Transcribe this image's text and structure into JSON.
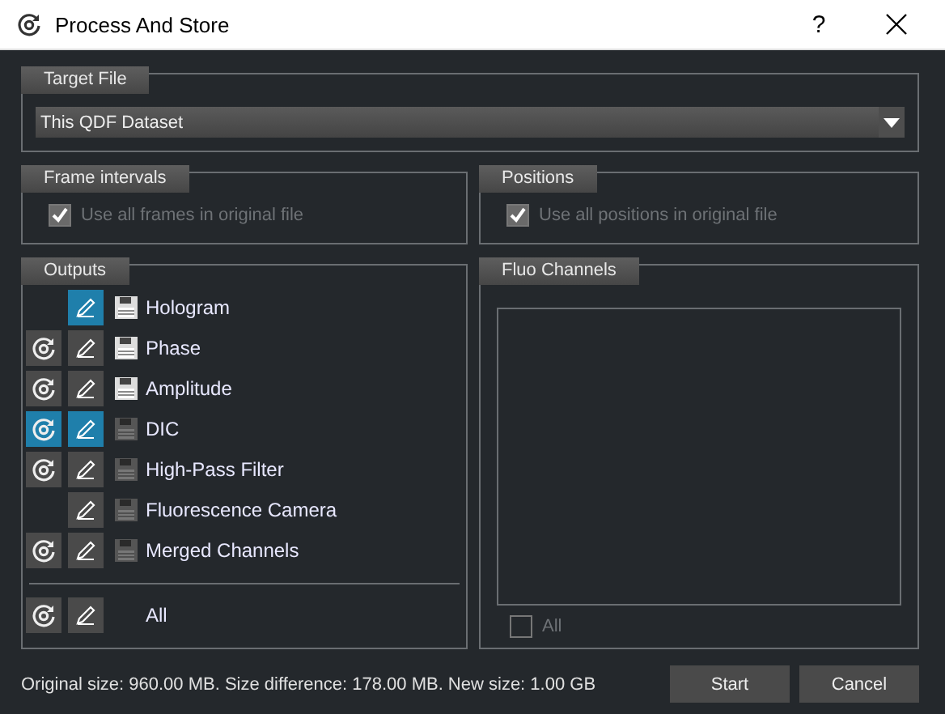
{
  "window": {
    "title": "Process And Store",
    "help": "?"
  },
  "target_file": {
    "title": "Target File",
    "value": "This QDF Dataset"
  },
  "frame_intervals": {
    "title": "Frame intervals",
    "checkbox": {
      "label": "Use all frames in original file",
      "checked": true,
      "disabled": true
    }
  },
  "positions": {
    "title": "Positions",
    "checkbox": {
      "label": "Use all positions in original file",
      "checked": true,
      "disabled": true
    }
  },
  "outputs": {
    "title": "Outputs",
    "rows": [
      {
        "label": "Hologram",
        "edit": {
          "selected": true
        },
        "save": {
          "enabled": true
        }
      },
      {
        "label": "Phase",
        "process": {
          "selected": false
        },
        "edit": {
          "selected": false
        },
        "save": {
          "enabled": true
        }
      },
      {
        "label": "Amplitude",
        "process": {
          "selected": false
        },
        "edit": {
          "selected": false
        },
        "save": {
          "enabled": true
        }
      },
      {
        "label": "DIC",
        "process": {
          "selected": true
        },
        "edit": {
          "selected": true
        },
        "save": {
          "enabled": false
        }
      },
      {
        "label": "High-Pass Filter",
        "process": {
          "selected": false
        },
        "edit": {
          "selected": false
        },
        "save": {
          "enabled": false
        }
      },
      {
        "label": "Fluorescence Camera",
        "edit": {
          "selected": false
        },
        "save": {
          "enabled": false
        }
      },
      {
        "label": "Merged Channels",
        "process": {
          "selected": false
        },
        "edit": {
          "selected": false
        },
        "save": {
          "enabled": false
        }
      }
    ],
    "all_row": {
      "label": "All",
      "process": {
        "selected": false
      },
      "edit": {
        "selected": false
      }
    }
  },
  "fluo_channels": {
    "title": "Fluo Channels",
    "all": {
      "label": "All",
      "checked": false,
      "disabled": true
    }
  },
  "status": "Original size: 960.00 MB. Size difference: 178.00 MB. New size: 1.00 GB",
  "buttons": [
    "Start",
    "Cancel"
  ]
}
